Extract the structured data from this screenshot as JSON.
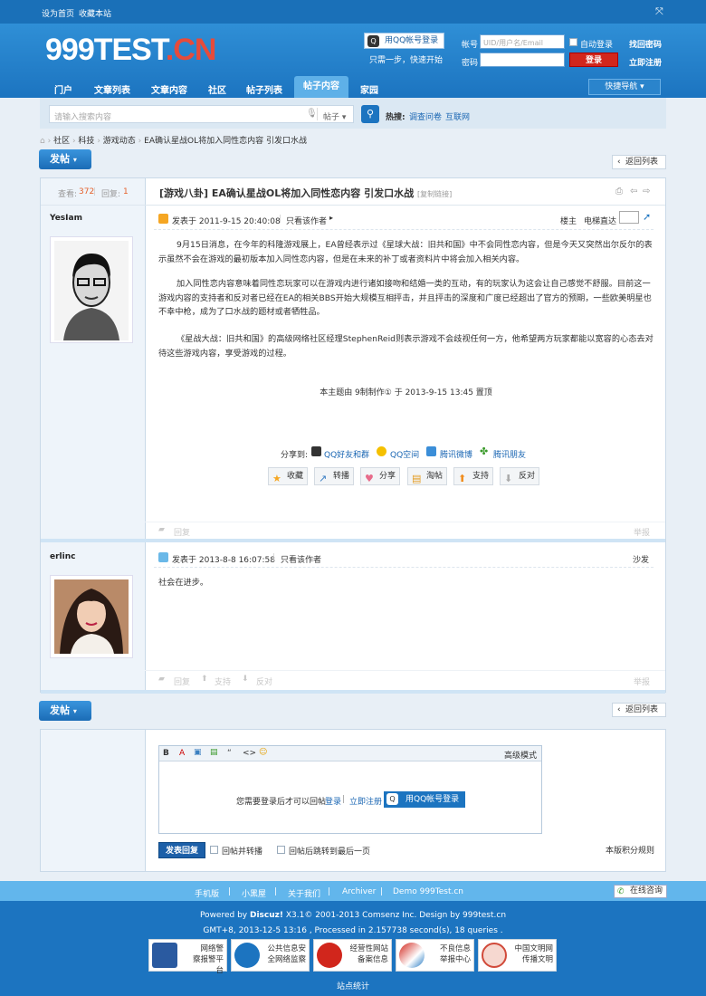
{
  "topbar": {
    "set_home": "设为首页",
    "bookmark": "收藏本站"
  },
  "header": {
    "logo_main": "999TEST",
    "logo_tld": ".CN",
    "qq_login": "用QQ帐号登录",
    "qq_hint": "只需一步，快速开始",
    "account_label": "帐号",
    "account_placeholder": "UID/用户名/Email",
    "auto_login": "自动登录",
    "forgot_password": "找回密码",
    "password_label": "密码",
    "login_button": "登录",
    "register": "立即注册"
  },
  "nav": {
    "items": [
      "门户",
      "文章列表",
      "文章内容",
      "社区",
      "帖子列表",
      "帖子内容",
      "家园"
    ],
    "active": "帖子内容",
    "quick_nav": "快捷导航"
  },
  "search": {
    "placeholder": "请输入搜索内容",
    "type": "帖子",
    "hot_label": "热搜:",
    "hot_items": [
      "调查问卷",
      "互联网"
    ]
  },
  "breadcrumb": [
    "社区",
    "科技",
    "游戏动态",
    "EA确认星战OL将加入同性恋内容 引发口水战"
  ],
  "post_button": "发帖",
  "back_list": "返回列表",
  "thread": {
    "views_label": "查看:",
    "views": "372",
    "replies_label": "回复:",
    "replies": "1",
    "title": "[游戏八卦] EA确认星战OL将加入同性恋内容 引发口水战",
    "copy_link": "[复制链接]"
  },
  "posts": [
    {
      "author": "YesIam",
      "time": "发表于 2011-9-15 20:40:08",
      "only_author": "只看该作者",
      "floor": "楼主",
      "jump_label": "电梯直达",
      "paragraphs": [
        "9月15日消息，在今年的科隆游戏展上，EA曾经表示过《星球大战：旧共和国》中不会同性恋内容，但是今天又突然出尔反尔的表示虽然不会在游戏的最初版本加入同性恋内容，但是在未来的补丁或者资料片中将会加入相关内容。",
        "加入同性恋内容意味着同性恋玩家可以在游戏内进行诸如接吻和结婚一类的互动，有的玩家认为这会让自己感觉不舒服。目前这一游戏内容的支持者和反对者已经在EA的相关BBS开始大规模互相抨击，并且抨击的深度和广度已经超出了官方的预期，一些欧美明星也不幸中枪，成为了口水战的题材或者牺牲品。",
        "《星战大战：旧共和国》的高级网络社区经理StephenReid则表示游戏不会歧视任何一方，他希望两方玩家都能以宽容的心态去对待这些游戏内容，享受游戏的过程。"
      ],
      "edit_note": "本主题由 9制制作① 于 2013-9-15 13:45 置顶",
      "share_label": "分享到:",
      "share_items": [
        "QQ好友和群",
        "QQ空间",
        "腾讯微博",
        "腾讯朋友"
      ],
      "actions": [
        "收藏",
        "转播",
        "分享",
        "淘帖",
        "支持",
        "反对"
      ],
      "reply": "回复",
      "report": "举报"
    },
    {
      "author": "erlinc",
      "time": "发表于 2013-8-8 16:07:58",
      "only_author": "只看该作者",
      "floor": "沙发",
      "content": "社会在进步。",
      "reply": "回复",
      "support": "支持",
      "oppose": "反对",
      "report": "举报"
    }
  ],
  "editor": {
    "toolbar": [
      "B",
      "A",
      "▣",
      "▤",
      "“",
      "<>",
      "☺"
    ],
    "advanced": "高级模式",
    "login_hint": "您需要登录后才可以回帖",
    "login": "登录",
    "sep": "|",
    "register": "立即注册",
    "qq_login": "用QQ帐号登录",
    "submit": "发表回复",
    "opt1": "回帖并转播",
    "opt2": "回帖后跳转到最后一页",
    "rules": "本版积分规则"
  },
  "footer": {
    "links": [
      "手机版",
      "小黑屋",
      "关于我们",
      "Archiver",
      "Demo 999Test.cn"
    ],
    "online": "在线咨询",
    "powered": "Powered by",
    "brand": "Discuz!",
    "version": " X3.1© 2001-2013 Comsenz Inc. Design by 999test.cn",
    "stats": "GMT+8, 2013-12-5 13:16 , Processed in 2.157738 second(s), 18 queries .",
    "badges": [
      [
        "网络警",
        "察报警平台"
      ],
      [
        "公共信息安",
        "全网络监察"
      ],
      [
        "经营性网站",
        "备案信息"
      ],
      [
        "不良信息",
        "举报中心"
      ],
      [
        "中国文明网",
        "传播文明"
      ]
    ],
    "site_stats": "站点统计"
  },
  "colors": {
    "brand_blue": "#1c74c0",
    "accent_red": "#d1261c",
    "link": "#1a66b3"
  }
}
